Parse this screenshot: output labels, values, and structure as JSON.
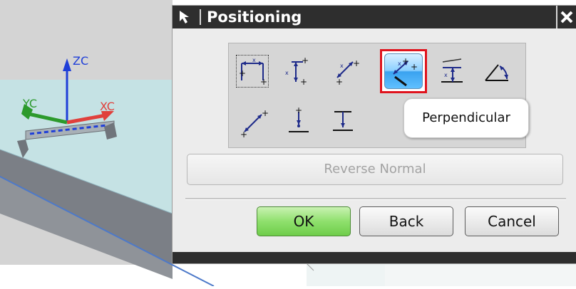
{
  "dialog": {
    "title": "Positioning",
    "tooltip": "Perpendicular",
    "reverse_normal_label": "Reverse Normal",
    "ok_label": "OK",
    "back_label": "Back",
    "cancel_label": "Cancel",
    "positioning_methods": [
      "horizontal",
      "vertical",
      "parallel",
      "perpendicular",
      "parallel-at-distance",
      "angular",
      "point-onto-point",
      "point-onto-line",
      "line-onto-line"
    ],
    "selected_method": "perpendicular"
  },
  "viewport": {
    "axes": {
      "z_label": "ZC",
      "y_label": "YC",
      "x_label": "XC"
    },
    "colors": {
      "z_axis": "#1f3fd8",
      "y_axis": "#2c9a2c",
      "x_axis": "#e0403c"
    }
  },
  "colors": {
    "selection_highlight": "#e0131d",
    "ok_button": "#7bd652",
    "titlebar": "#2e2e2e"
  }
}
